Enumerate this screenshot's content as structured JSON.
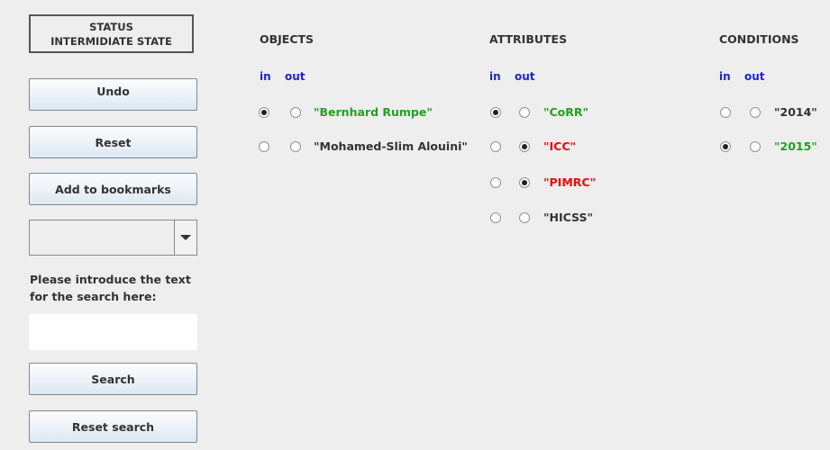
{
  "status": {
    "line1": "STATUS",
    "line2": "INTERMIDIATE STATE"
  },
  "buttons": {
    "undo": "Undo",
    "reset": "Reset",
    "bookmarks": "Add to bookmarks",
    "search": "Search",
    "reset_search": "Reset search"
  },
  "dropdown": {
    "selected": ""
  },
  "search": {
    "label_line1": "Please introduce the text",
    "label_line2": "for the search here:",
    "value": ""
  },
  "columns": {
    "objects": {
      "header": "OBJECTS",
      "in_label": "in",
      "out_label": "out",
      "items": [
        {
          "label": "\"Bernhard Rumpe\"",
          "state": "in",
          "color": "#22a022"
        },
        {
          "label": "\"Mohamed-Slim Alouini\"",
          "state": "none",
          "color": "#333333"
        }
      ]
    },
    "attributes": {
      "header": "ATTRIBUTES",
      "in_label": "in",
      "out_label": "out",
      "items": [
        {
          "label": "\"CoRR\"",
          "state": "in",
          "color": "#22a022"
        },
        {
          "label": "\"ICC\"",
          "state": "out",
          "color": "#e01010"
        },
        {
          "label": "\"PIMRC\"",
          "state": "out",
          "color": "#e01010"
        },
        {
          "label": "\"HICSS\"",
          "state": "none",
          "color": "#333333"
        }
      ]
    },
    "conditions": {
      "header": "CONDITIONS",
      "in_label": "in",
      "out_label": "out",
      "items": [
        {
          "label": "\"2014\"",
          "state": "none",
          "color": "#333333"
        },
        {
          "label": "\"2015\"",
          "state": "in",
          "color": "#22a022"
        }
      ]
    }
  }
}
